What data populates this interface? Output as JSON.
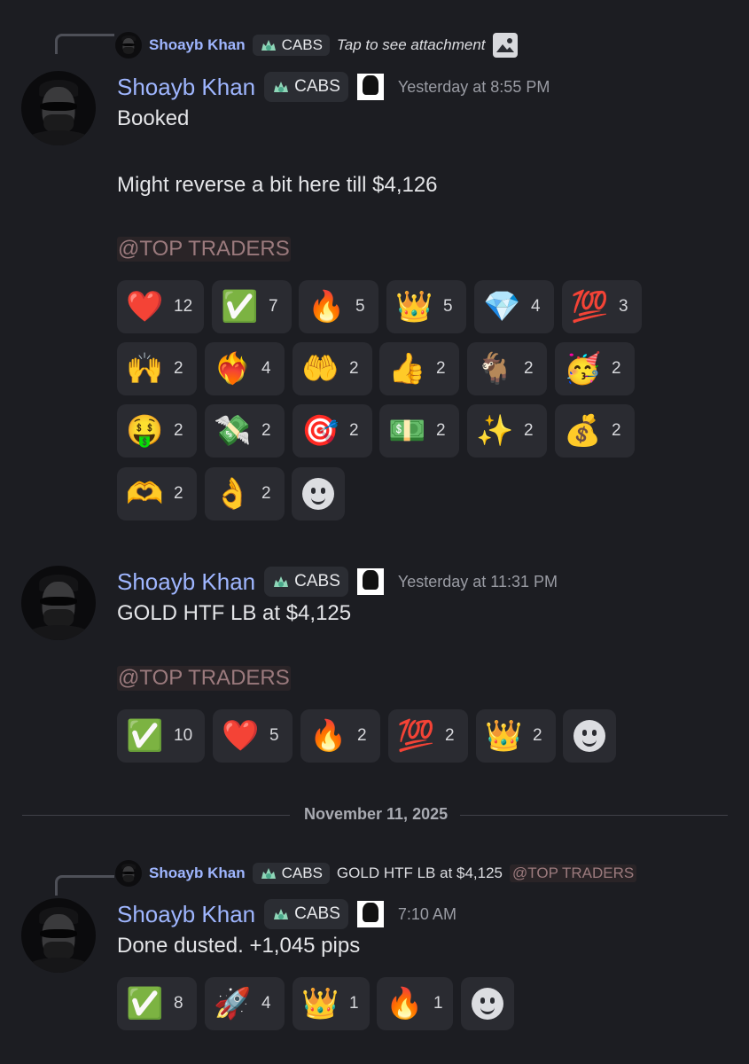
{
  "messages": [
    {
      "reply": {
        "author": "Shoayb Khan",
        "tag": "CABS",
        "text": "Tap to see attachment",
        "icon": "image-icon"
      },
      "author": "Shoayb Khan",
      "tag": "CABS",
      "timestamp": "Yesterday at 8:55 PM",
      "lines": [
        "Booked",
        "Might reverse a bit here till $4,126"
      ],
      "mention": "@TOP TRADERS",
      "reactions": [
        {
          "emoji": "❤️",
          "count": "12"
        },
        {
          "emoji": "✅",
          "count": "7"
        },
        {
          "emoji": "🔥",
          "count": "5"
        },
        {
          "emoji": "👑",
          "count": "5"
        },
        {
          "emoji": "💎",
          "count": "4"
        },
        {
          "emoji": "💯",
          "count": "3"
        },
        {
          "emoji": "🙌",
          "count": "2"
        },
        {
          "emoji": "❤️‍🔥",
          "count": "4"
        },
        {
          "emoji": "🤲",
          "count": "2"
        },
        {
          "emoji": "👍",
          "count": "2"
        },
        {
          "emoji": "🐐",
          "count": "2"
        },
        {
          "emoji": "🥳",
          "count": "2"
        },
        {
          "emoji": "🤑",
          "count": "2"
        },
        {
          "emoji": "💸",
          "count": "2"
        },
        {
          "emoji": "🎯",
          "count": "2"
        },
        {
          "emoji": "💵",
          "count": "2"
        },
        {
          "emoji": "✨",
          "count": "2"
        },
        {
          "emoji": "💰",
          "count": "2"
        },
        {
          "emoji": "🫶",
          "count": "2"
        },
        {
          "emoji": "👌",
          "count": "2"
        }
      ]
    },
    {
      "author": "Shoayb Khan",
      "tag": "CABS",
      "timestamp": "Yesterday at 11:31 PM",
      "lines": [
        "GOLD HTF LB at $4,125"
      ],
      "mention": "@TOP TRADERS",
      "reactions": [
        {
          "emoji": "✅",
          "count": "10"
        },
        {
          "emoji": "❤️",
          "count": "5"
        },
        {
          "emoji": "🔥",
          "count": "2"
        },
        {
          "emoji": "💯",
          "count": "2"
        },
        {
          "emoji": "👑",
          "count": "2"
        }
      ]
    },
    {
      "reply": {
        "author": "Shoayb Khan",
        "tag": "CABS",
        "text": "GOLD HTF LB at $4,125",
        "mention": "@TOP TRADERS"
      },
      "author": "Shoayb Khan",
      "tag": "CABS",
      "timestamp": "7:10 AM",
      "lines": [
        "Done dusted. +1,045 pips"
      ],
      "reactions": [
        {
          "emoji": "✅",
          "count": "8"
        },
        {
          "emoji": "🚀",
          "count": "4"
        },
        {
          "emoji": "👑",
          "count": "1"
        },
        {
          "emoji": "🔥",
          "count": "1"
        }
      ]
    }
  ],
  "date_divider": "November 11, 2025",
  "colors": {
    "background": "#1c1d22",
    "name": "#9fb6ff",
    "mention": "#9b7a7d",
    "reaction_bg": "#2a2b31"
  }
}
